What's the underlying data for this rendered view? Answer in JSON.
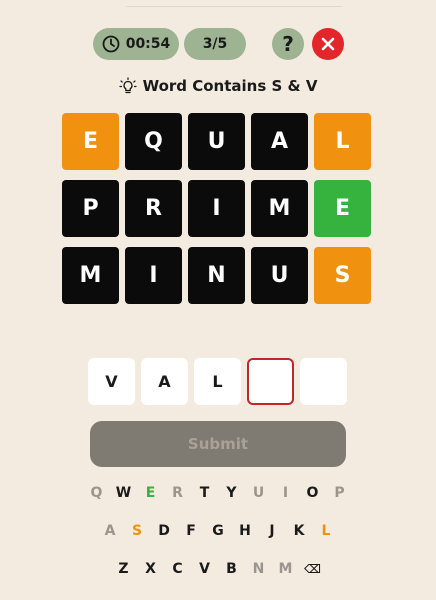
{
  "header": {
    "timer": "00:54",
    "round": "3/5",
    "help_label": "?",
    "icons": {
      "timer": "clock-icon",
      "close": "close-icon",
      "hint": "lightbulb-icon"
    }
  },
  "hint": {
    "text": "Word Contains S & V"
  },
  "board": {
    "rows": [
      [
        {
          "letter": "E",
          "state": "present"
        },
        {
          "letter": "Q",
          "state": "absent"
        },
        {
          "letter": "U",
          "state": "absent"
        },
        {
          "letter": "A",
          "state": "absent"
        },
        {
          "letter": "L",
          "state": "present"
        }
      ],
      [
        {
          "letter": "P",
          "state": "absent"
        },
        {
          "letter": "R",
          "state": "absent"
        },
        {
          "letter": "I",
          "state": "absent"
        },
        {
          "letter": "M",
          "state": "absent"
        },
        {
          "letter": "E",
          "state": "correct"
        }
      ],
      [
        {
          "letter": "M",
          "state": "absent"
        },
        {
          "letter": "I",
          "state": "absent"
        },
        {
          "letter": "N",
          "state": "absent"
        },
        {
          "letter": "U",
          "state": "absent"
        },
        {
          "letter": "S",
          "state": "present"
        }
      ]
    ]
  },
  "guess": {
    "letters": [
      "V",
      "A",
      "L",
      "",
      ""
    ],
    "active_index": 3
  },
  "submit": {
    "label": "Submit"
  },
  "keyboard": {
    "rows": [
      [
        {
          "k": "Q",
          "s": "absent"
        },
        {
          "k": "W",
          "s": "unused"
        },
        {
          "k": "E",
          "s": "correct"
        },
        {
          "k": "R",
          "s": "absent"
        },
        {
          "k": "T",
          "s": "unused"
        },
        {
          "k": "Y",
          "s": "unused"
        },
        {
          "k": "U",
          "s": "absent"
        },
        {
          "k": "I",
          "s": "absent"
        },
        {
          "k": "O",
          "s": "unused"
        },
        {
          "k": "P",
          "s": "absent"
        }
      ],
      [
        {
          "k": "A",
          "s": "absent"
        },
        {
          "k": "S",
          "s": "present"
        },
        {
          "k": "D",
          "s": "unused"
        },
        {
          "k": "F",
          "s": "unused"
        },
        {
          "k": "G",
          "s": "unused"
        },
        {
          "k": "H",
          "s": "unused"
        },
        {
          "k": "J",
          "s": "unused"
        },
        {
          "k": "K",
          "s": "unused"
        },
        {
          "k": "L",
          "s": "present"
        }
      ],
      [
        {
          "k": "Z",
          "s": "unused"
        },
        {
          "k": "X",
          "s": "unused"
        },
        {
          "k": "C",
          "s": "unused"
        },
        {
          "k": "V",
          "s": "unused"
        },
        {
          "k": "B",
          "s": "unused"
        },
        {
          "k": "N",
          "s": "absent"
        },
        {
          "k": "M",
          "s": "absent"
        },
        {
          "k": "⌫",
          "s": "unused",
          "name": "backspace"
        }
      ]
    ]
  },
  "colors": {
    "background": "#f3ebe0",
    "tile_absent": "#0b0b0b",
    "tile_present": "#f0920f",
    "tile_correct": "#35b33e",
    "pill": "#9db392",
    "close": "#e3262a"
  }
}
